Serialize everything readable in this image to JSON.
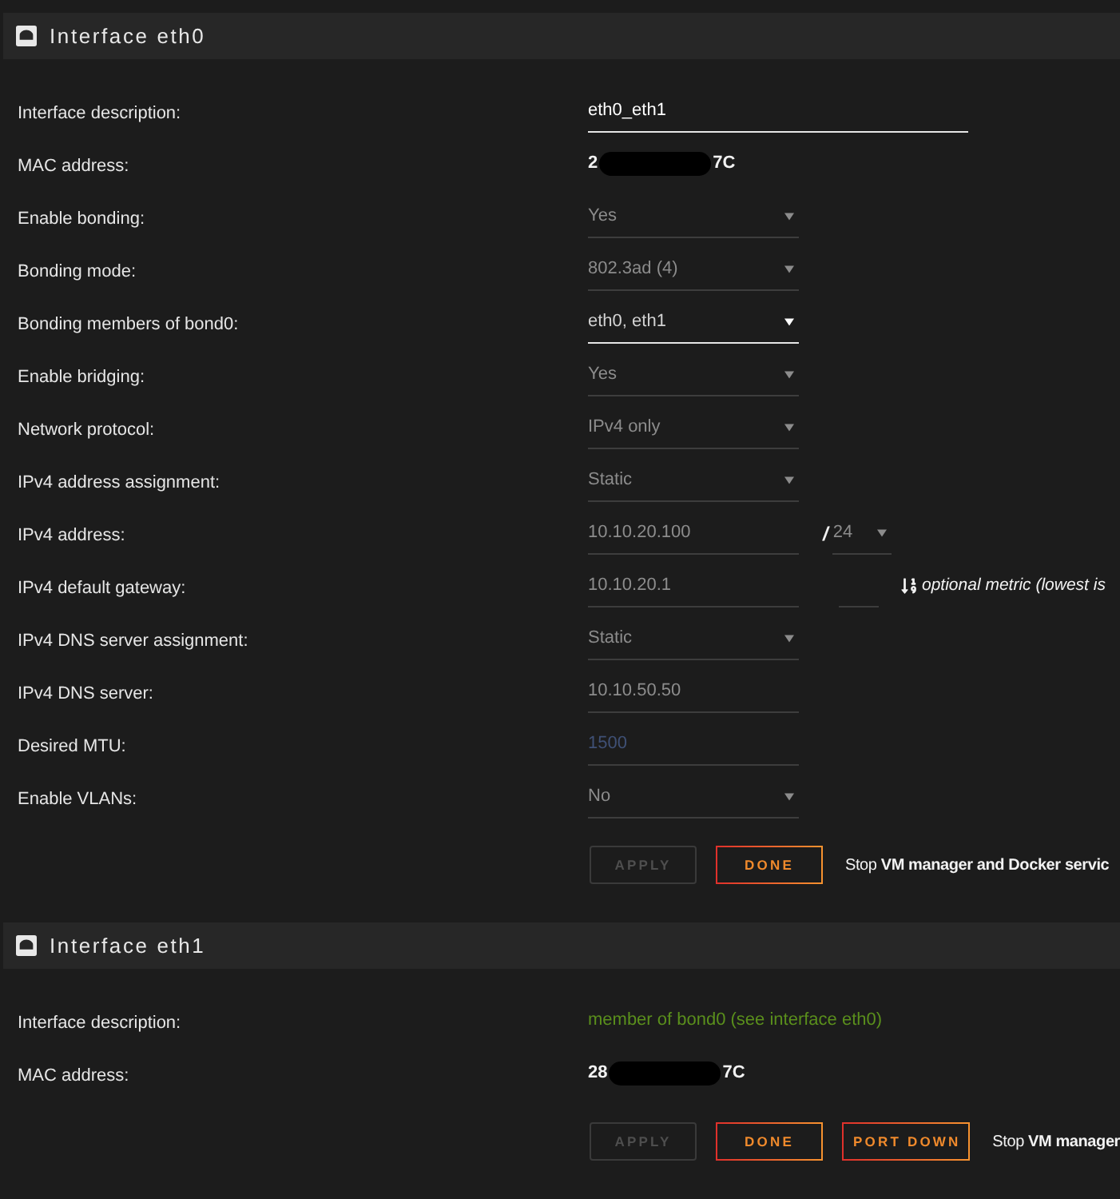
{
  "sections": [
    {
      "title": "Interface eth0",
      "rows": [
        {
          "kind": "description",
          "label": "Interface description:",
          "value": "eth0_eth1",
          "disabled": false
        },
        {
          "kind": "mac",
          "label": "MAC address:",
          "value_start": "2",
          "value_end": "7C"
        },
        {
          "kind": "select",
          "label": "Enable bonding:",
          "value": "Yes",
          "disabled": true
        },
        {
          "kind": "select",
          "label": "Bonding mode:",
          "value": "802.3ad (4)",
          "disabled": true
        },
        {
          "kind": "select",
          "label": "Bonding members of bond0:",
          "value": "eth0, eth1",
          "disabled": false
        },
        {
          "kind": "select",
          "label": "Enable bridging:",
          "value": "Yes",
          "disabled": true
        },
        {
          "kind": "select",
          "label": "Network protocol:",
          "value": "IPv4 only",
          "disabled": true
        },
        {
          "kind": "select",
          "label": "IPv4 address assignment:",
          "value": "Static",
          "disabled": true
        },
        {
          "kind": "address",
          "label": "IPv4 address:",
          "value": "10.10.20.100",
          "disabled": true,
          "separator": "/",
          "prefix": {
            "value": "24",
            "disabled": true
          }
        },
        {
          "kind": "gateway",
          "label": "IPv4 default gateway:",
          "value": "10.10.20.1",
          "disabled": true,
          "metric": {
            "disabled": true
          },
          "hint": "optional metric (lowest is"
        },
        {
          "kind": "select",
          "label": "IPv4 DNS server assignment:",
          "value": "Static",
          "disabled": true
        },
        {
          "kind": "input",
          "label": "IPv4 DNS server:",
          "value": "10.10.50.50",
          "disabled": true
        },
        {
          "kind": "input",
          "label": "Desired MTU:",
          "placeholder": "1500",
          "disabled": true
        },
        {
          "kind": "select",
          "label": "Enable VLANs:",
          "value": "No",
          "disabled": true
        }
      ],
      "buttons": [
        {
          "label": "APPLY",
          "disabled": true
        },
        {
          "label": "DONE",
          "disabled": false
        }
      ],
      "notice": "Stop **VM manager and Docker servic**"
    },
    {
      "title": "Interface eth1",
      "rows": [
        {
          "kind": "note",
          "label": "Interface description:",
          "value": "member of bond0 (see interface eth0)"
        },
        {
          "kind": "mac",
          "label": "MAC address:",
          "value_start": "28",
          "value_end": "7C"
        }
      ],
      "buttons": [
        {
          "label": "APPLY",
          "disabled": true
        },
        {
          "label": "DONE",
          "disabled": false
        },
        {
          "label": "PORT DOWN",
          "disabled": false
        }
      ],
      "notice": "Stop **VM manager**"
    }
  ]
}
